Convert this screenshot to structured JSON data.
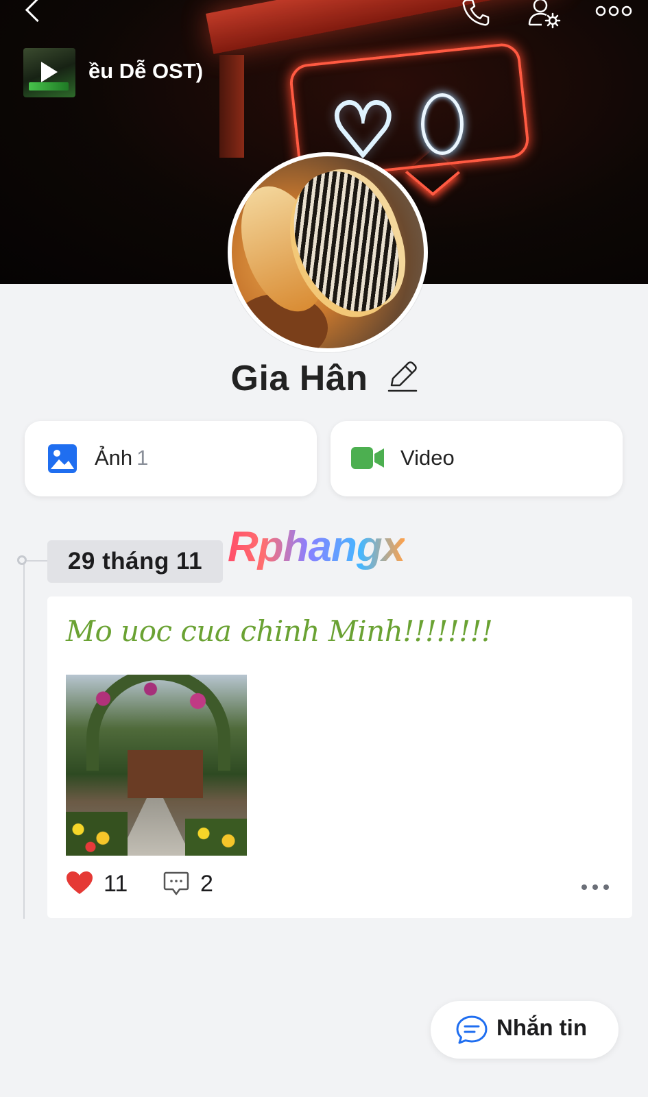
{
  "header": {
    "now_playing": "ều Dễ OST)"
  },
  "profile": {
    "name": "Gia Hân"
  },
  "media": {
    "photo_label": "Ảnh",
    "photo_count": "1",
    "video_label": "Video"
  },
  "timeline": {
    "date": "29 tháng 11",
    "watermark": "Rphangx"
  },
  "post": {
    "text": "Mo uoc cua chinh Minh!!!!!!!!",
    "likes": "11",
    "comments": "2"
  },
  "actions": {
    "message_label": "Nhắn tin"
  },
  "colors": {
    "accent_blue": "#1f6ef0",
    "video_green": "#4caf50",
    "like_red": "#e53935",
    "post_text_green": "#6aa233"
  },
  "icons": {
    "back": "chevron-left-icon",
    "phone": "phone-icon",
    "user_settings": "user-settings-icon",
    "more": "more-horizontal-icon",
    "play": "play-icon",
    "edit": "pencil-icon",
    "photo": "image-icon",
    "video": "video-camera-icon",
    "like": "heart-icon",
    "comment": "comment-icon",
    "message": "chat-bubble-icon"
  }
}
